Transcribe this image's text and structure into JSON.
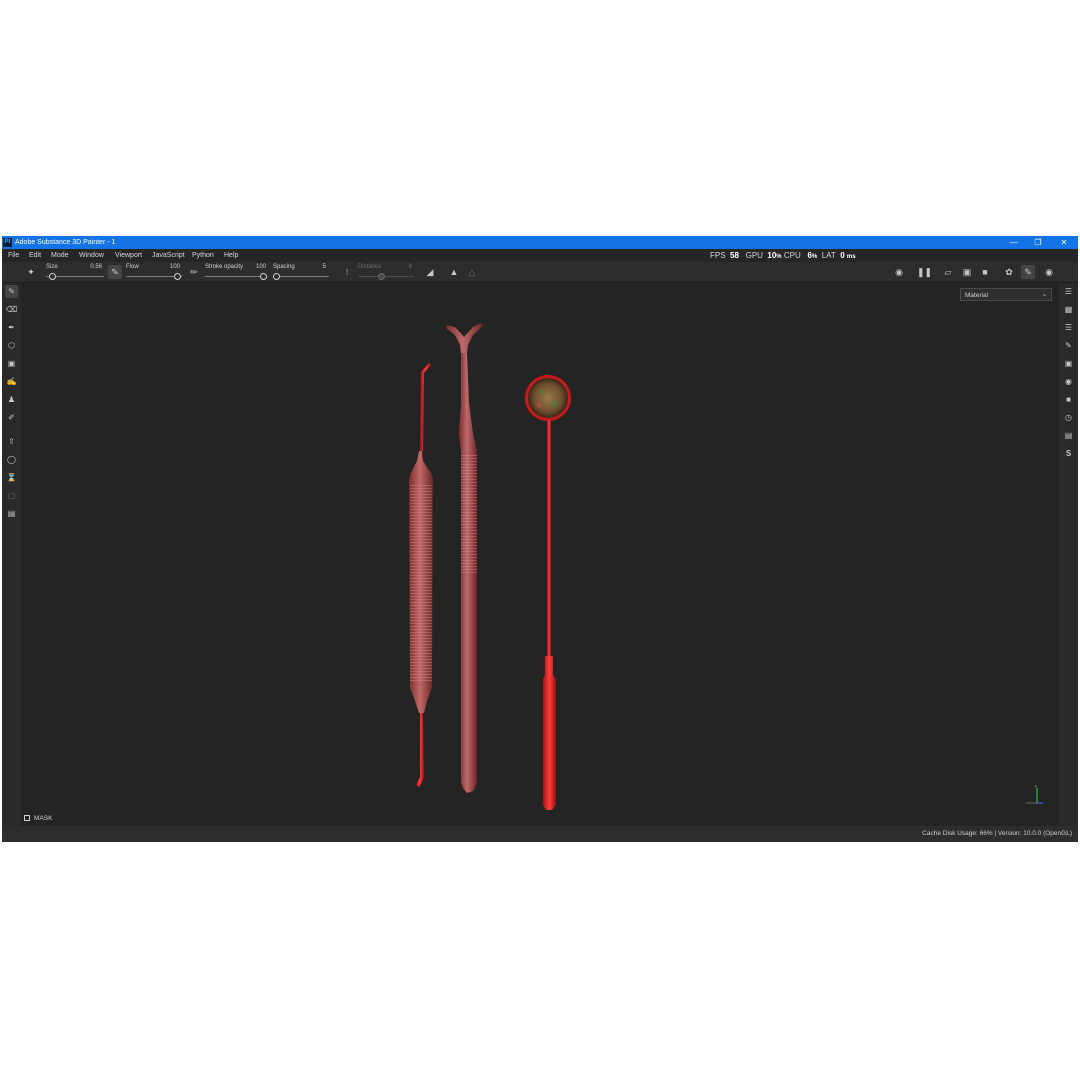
{
  "window": {
    "app_icon": "Pt",
    "title": "Adobe Substance 3D Painter - 1",
    "controls": [
      "minimize-icon",
      "restore-icon",
      "close-icon"
    ]
  },
  "menu": {
    "items": [
      "File",
      "Edit",
      "Mode",
      "Window",
      "Viewport",
      "JavaScript",
      "Python",
      "Help"
    ]
  },
  "perf": {
    "fps_label": "FPS",
    "fps_value": "58",
    "gpu_label": "GPU",
    "gpu_value": "10",
    "cpu_label": "CPU",
    "cpu_value": "6",
    "lat_label": "LAT",
    "lat_value": "0",
    "percent": "%",
    "ms": "ms"
  },
  "toolbar": {
    "size_label": "Size",
    "size_value": "0.56",
    "size_level": 0.05,
    "flow_label": "Flow",
    "flow_value": "100",
    "flow_level": 1.0,
    "stroke_opacity_label": "Stroke opacity",
    "stroke_opacity_value": "100",
    "stroke_opacity_level": 1.0,
    "spacing_label": "Spacing",
    "spacing_value": "5",
    "spacing_level": 0.0,
    "distance_label": "Distance",
    "distance_value": "8",
    "distance_level": 0.5
  },
  "viewport": {
    "channel_select": "Material",
    "mask_label": "MASK",
    "accent_color": "#d32020"
  },
  "status": {
    "text": "Cache Disk Usage:   66% | Version: 10.0.0 (OpenGL)"
  },
  "left_tools": [
    "paint-brush-icon",
    "eraser-icon",
    "projection-icon",
    "geometry-fill-icon",
    "polygon-fill-icon",
    "smudge-icon",
    "clone-stamp-icon",
    "color-picker-icon",
    "bake-export-icon",
    "quick-mask-icon",
    "disabled-tool-icon",
    "disabled-tool-icon",
    "notes-icon"
  ],
  "right_panels": [
    "layers-panel-icon",
    "texture-set-icon",
    "layer-stack-icon",
    "properties-icon",
    "display-settings-icon",
    "environment-icon",
    "shelf-icon",
    "history-icon",
    "log-icon",
    "substance-icon"
  ]
}
